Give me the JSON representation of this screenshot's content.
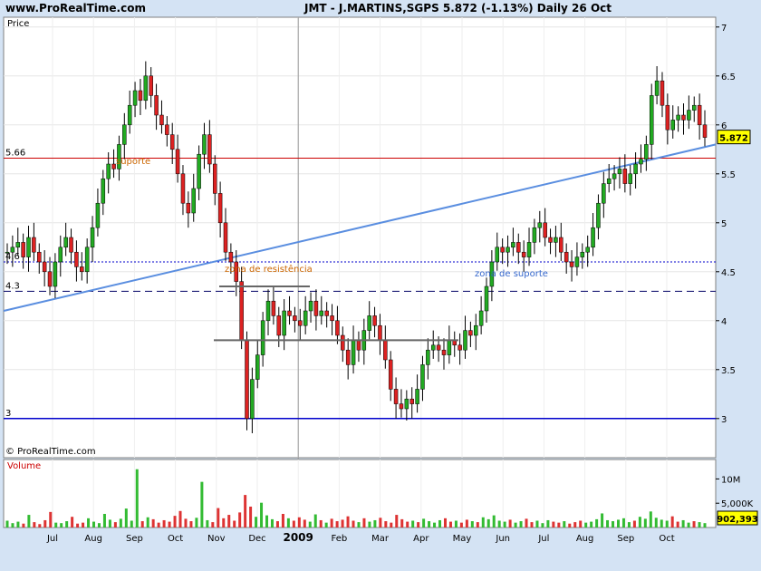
{
  "header": {
    "site": "www.ProRealTime.com",
    "title": "JMT - J.MARTINS,SGPS     5.872 (-1.13%)     Daily  26 Oct"
  },
  "chart_data": [
    {
      "type": "candlestick",
      "panel_label": "Price",
      "copyright": "© ProRealTime.com",
      "last_price": "5.872",
      "ylim": [
        2.6,
        7.1
      ],
      "y_ticks": [
        "7",
        "6.5",
        "6",
        "5.5",
        "5",
        "4.5",
        "4",
        "3.5",
        "3"
      ],
      "x_labels": [
        "Jul",
        "Aug",
        "Sep",
        "Oct",
        "Nov",
        "Dec",
        "2009",
        "Feb",
        "Mar",
        "Apr",
        "May",
        "Jun",
        "Jul",
        "Aug",
        "Sep",
        "Oct"
      ],
      "levels": [
        {
          "value": 5.66,
          "label": "5.66",
          "style": "solid",
          "color": "#cc0000"
        },
        {
          "value": 4.6,
          "label": "4.6",
          "style": "dotted",
          "color": "#0000cc"
        },
        {
          "value": 4.3,
          "label": "4.3",
          "style": "dashed",
          "color": "#000066"
        },
        {
          "value": 3.0,
          "label": "3",
          "style": "solid",
          "color": "#0000cc"
        }
      ],
      "annotations": [
        {
          "text": "suporte",
          "color": "#cc6600"
        },
        {
          "text": "zona de resistência",
          "color": "#cc6600"
        },
        {
          "text": "zona de suporte",
          "color": "#3366cc"
        }
      ],
      "trendline": {
        "start": {
          "date": "2008-06-01",
          "value": 4.1
        },
        "end": {
          "date": "2009-10-31",
          "value": 5.8
        },
        "color": "#5a8ee0"
      },
      "closes": [
        4.7,
        4.75,
        4.8,
        4.65,
        4.85,
        4.7,
        4.6,
        4.5,
        4.35,
        4.6,
        4.75,
        4.85,
        4.7,
        4.55,
        4.5,
        4.75,
        4.95,
        5.2,
        5.45,
        5.6,
        5.55,
        5.8,
        6.0,
        6.2,
        6.35,
        6.25,
        6.5,
        6.3,
        6.1,
        6.0,
        5.9,
        5.75,
        5.5,
        5.2,
        5.1,
        5.35,
        5.7,
        5.9,
        5.6,
        5.3,
        5.0,
        4.7,
        4.6,
        4.4,
        3.8,
        3.0,
        3.4,
        3.65,
        4.0,
        4.2,
        4.05,
        3.85,
        4.1,
        4.05,
        4.0,
        3.95,
        4.1,
        4.2,
        4.05,
        4.1,
        4.05,
        4.0,
        3.85,
        3.7,
        3.55,
        3.8,
        3.7,
        3.9,
        4.05,
        3.95,
        3.8,
        3.6,
        3.3,
        3.15,
        3.1,
        3.2,
        3.15,
        3.3,
        3.55,
        3.7,
        3.75,
        3.7,
        3.65,
        3.8,
        3.75,
        3.7,
        3.9,
        3.85,
        3.95,
        4.1,
        4.35,
        4.6,
        4.75,
        4.7,
        4.75,
        4.8,
        4.7,
        4.65,
        4.8,
        4.95,
        5.0,
        4.85,
        4.8,
        4.85,
        4.7,
        4.6,
        4.55,
        4.65,
        4.7,
        4.75,
        4.95,
        5.2,
        5.4,
        5.45,
        5.5,
        5.55,
        5.4,
        5.5,
        5.6,
        5.65,
        5.8,
        6.3,
        6.45,
        6.2,
        5.95,
        6.05,
        6.1,
        6.05,
        6.15,
        6.2,
        6.0,
        5.872
      ],
      "volume_panel": {
        "label": "Volume",
        "y_ticks": [
          "10M",
          "5,000K"
        ],
        "last_value": "902,393",
        "ymax_millions": 14,
        "values_millions": [
          1.4,
          0.9,
          1.2,
          0.8,
          2.6,
          1.1,
          0.7,
          1.5,
          3.2,
          1.0,
          0.9,
          1.3,
          2.2,
          0.8,
          1.0,
          1.9,
          1.2,
          0.9,
          2.8,
          1.6,
          1.1,
          1.8,
          3.9,
          1.4,
          12.0,
          1.3,
          2.1,
          1.7,
          1.0,
          1.5,
          1.2,
          2.4,
          3.4,
          1.8,
          1.3,
          2.0,
          9.4,
          1.5,
          1.1,
          4.0,
          1.9,
          2.6,
          1.4,
          3.1,
          6.7,
          4.3,
          2.2,
          5.1,
          2.5,
          1.7,
          1.3,
          2.8,
          1.9,
          1.4,
          2.1,
          1.6,
          1.2,
          2.7,
          1.5,
          1.0,
          1.8,
          1.3,
          1.6,
          2.3,
          1.4,
          1.1,
          1.9,
          1.2,
          1.5,
          2.0,
          1.3,
          1.0,
          2.6,
          1.7,
          1.2,
          1.4,
          1.1,
          1.8,
          1.3,
          1.0,
          1.5,
          1.9,
          1.2,
          1.4,
          1.0,
          1.6,
          1.3,
          1.1,
          2.1,
          1.7,
          2.5,
          1.4,
          1.2,
          1.6,
          1.0,
          1.3,
          1.8,
          1.1,
          1.4,
          0.9,
          1.5,
          1.2,
          1.0,
          1.3,
          0.8,
          1.1,
          1.4,
          1.0,
          1.2,
          1.7,
          2.9,
          1.5,
          1.3,
          1.6,
          1.9,
          1.1,
          1.4,
          2.2,
          1.8,
          3.3,
          2.0,
          1.6,
          1.4,
          2.3,
          1.2,
          1.5,
          1.0,
          1.3,
          1.1,
          0.9
        ]
      }
    }
  ]
}
